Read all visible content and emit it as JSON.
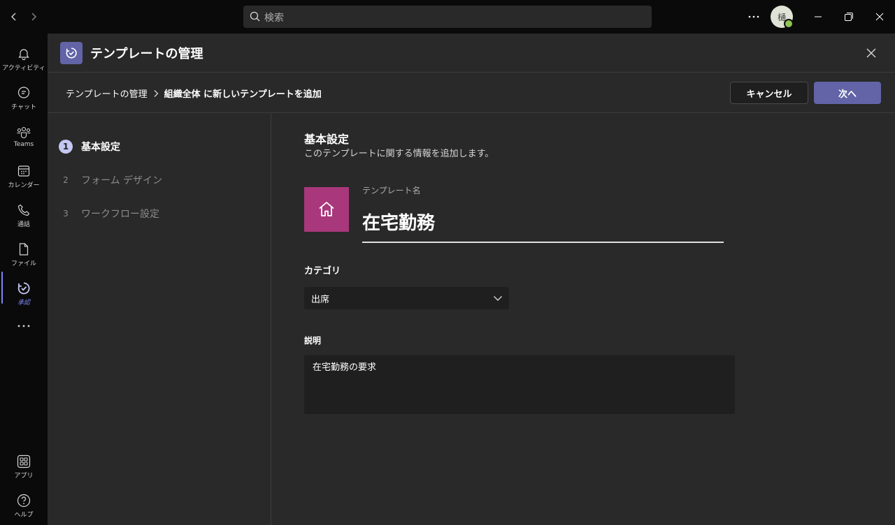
{
  "titlebar": {
    "search_placeholder": "検索",
    "avatar_initial": "樋"
  },
  "rail": {
    "items": [
      {
        "label": "アクティビティ",
        "icon": "bell-icon"
      },
      {
        "label": "チャット",
        "icon": "chat-icon"
      },
      {
        "label": "Teams",
        "icon": "teams-icon"
      },
      {
        "label": "カレンダー",
        "icon": "calendar-icon"
      },
      {
        "label": "通話",
        "icon": "phone-icon"
      },
      {
        "label": "ファイル",
        "icon": "file-icon"
      },
      {
        "label": "承認",
        "icon": "approvals-icon",
        "active": true
      }
    ],
    "bottom": [
      {
        "label": "アプリ",
        "icon": "apps-icon"
      },
      {
        "label": "ヘルプ",
        "icon": "help-icon"
      }
    ]
  },
  "header": {
    "title": "テンプレートの管理"
  },
  "breadcrumb": {
    "root": "テンプレートの管理",
    "current": "組織全体 に新しいテンプレートを追加"
  },
  "actions": {
    "cancel": "キャンセル",
    "next": "次へ"
  },
  "steps": [
    {
      "num": "1",
      "label": "基本設定",
      "active": true
    },
    {
      "num": "2",
      "label": "フォーム デザイン",
      "active": false
    },
    {
      "num": "3",
      "label": "ワークフロー設定",
      "active": false
    }
  ],
  "form": {
    "section_title": "基本設定",
    "section_subtitle": "このテンプレートに関する情報を追加します。",
    "template_icon": "home-icon",
    "template_icon_color": "#a8387b",
    "name_label": "テンプレート名",
    "name_value": "在宅勤務",
    "category_label": "カテゴリ",
    "category_value": "出席",
    "description_label": "説明",
    "description_value": "在宅勤務の要求"
  },
  "colors": {
    "accent": "#6264a7",
    "rail_active": "#7f85f5",
    "presence": "#92c353"
  }
}
